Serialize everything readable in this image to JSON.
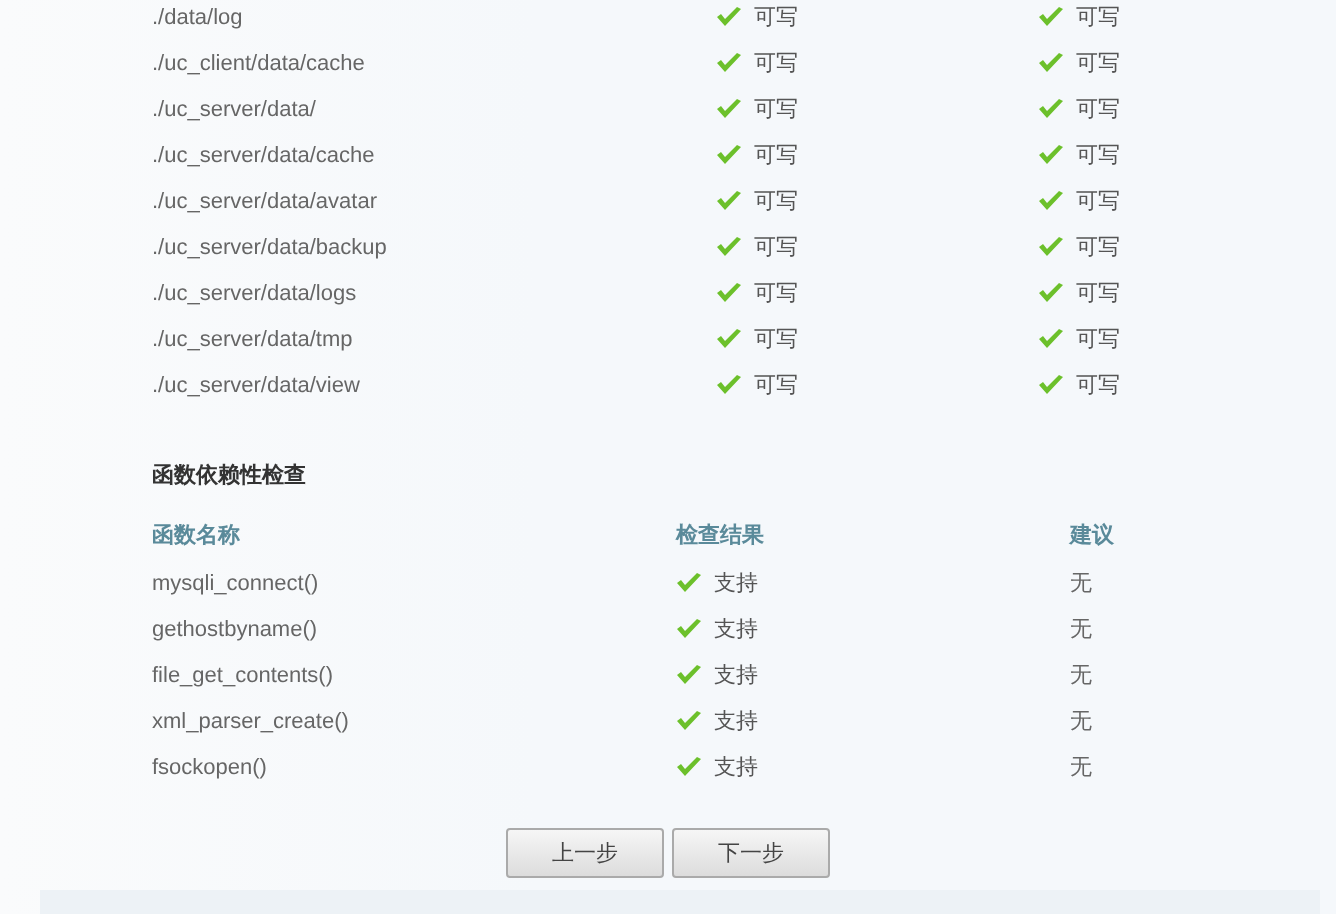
{
  "directories": [
    {
      "path": "./data/log",
      "current": {
        "ok": true,
        "text": "可写"
      },
      "required": {
        "ok": true,
        "text": "可写"
      }
    },
    {
      "path": "./uc_client/data/cache",
      "current": {
        "ok": true,
        "text": "可写"
      },
      "required": {
        "ok": true,
        "text": "可写"
      }
    },
    {
      "path": "./uc_server/data/",
      "current": {
        "ok": true,
        "text": "可写"
      },
      "required": {
        "ok": true,
        "text": "可写"
      }
    },
    {
      "path": "./uc_server/data/cache",
      "current": {
        "ok": true,
        "text": "可写"
      },
      "required": {
        "ok": true,
        "text": "可写"
      }
    },
    {
      "path": "./uc_server/data/avatar",
      "current": {
        "ok": true,
        "text": "可写"
      },
      "required": {
        "ok": true,
        "text": "可写"
      }
    },
    {
      "path": "./uc_server/data/backup",
      "current": {
        "ok": true,
        "text": "可写"
      },
      "required": {
        "ok": true,
        "text": "可写"
      }
    },
    {
      "path": "./uc_server/data/logs",
      "current": {
        "ok": true,
        "text": "可写"
      },
      "required": {
        "ok": true,
        "text": "可写"
      }
    },
    {
      "path": "./uc_server/data/tmp",
      "current": {
        "ok": true,
        "text": "可写"
      },
      "required": {
        "ok": true,
        "text": "可写"
      }
    },
    {
      "path": "./uc_server/data/view",
      "current": {
        "ok": true,
        "text": "可写"
      },
      "required": {
        "ok": true,
        "text": "可写"
      }
    }
  ],
  "functions": {
    "title": "函数依赖性检查",
    "columns": [
      "函数名称",
      "检查结果",
      "建议"
    ],
    "rows": [
      {
        "name": "mysqli_connect()",
        "ok": true,
        "result": "支持",
        "advice": "无"
      },
      {
        "name": "gethostbyname()",
        "ok": true,
        "result": "支持",
        "advice": "无"
      },
      {
        "name": "file_get_contents()",
        "ok": true,
        "result": "支持",
        "advice": "无"
      },
      {
        "name": "xml_parser_create()",
        "ok": true,
        "result": "支持",
        "advice": "无"
      },
      {
        "name": "fsockopen()",
        "ok": true,
        "result": "支持",
        "advice": "无"
      }
    ]
  },
  "buttons": [
    "上一步",
    "下一步"
  ]
}
